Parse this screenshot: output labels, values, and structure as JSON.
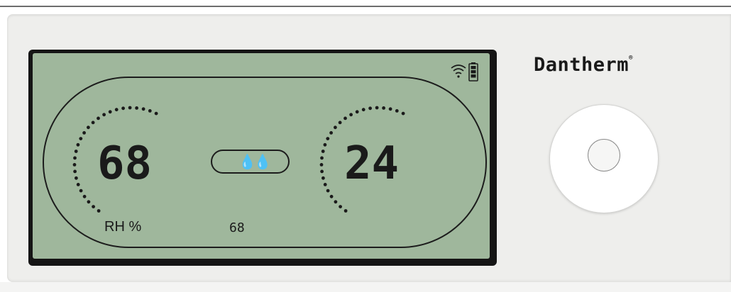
{
  "brand": {
    "name": "Dantherm",
    "mark": "®"
  },
  "display": {
    "humidity_value": "68",
    "humidity_label": "RH %",
    "setpoint_value": "68",
    "temperature_value": "24",
    "mode_icon": "water-drops-icon",
    "status_icons": [
      "wifi-icon",
      "battery-icon"
    ]
  },
  "colors": {
    "lcd_background": "#9fb79c",
    "segment": "#1a1a1a",
    "housing": "#eeeeec"
  }
}
